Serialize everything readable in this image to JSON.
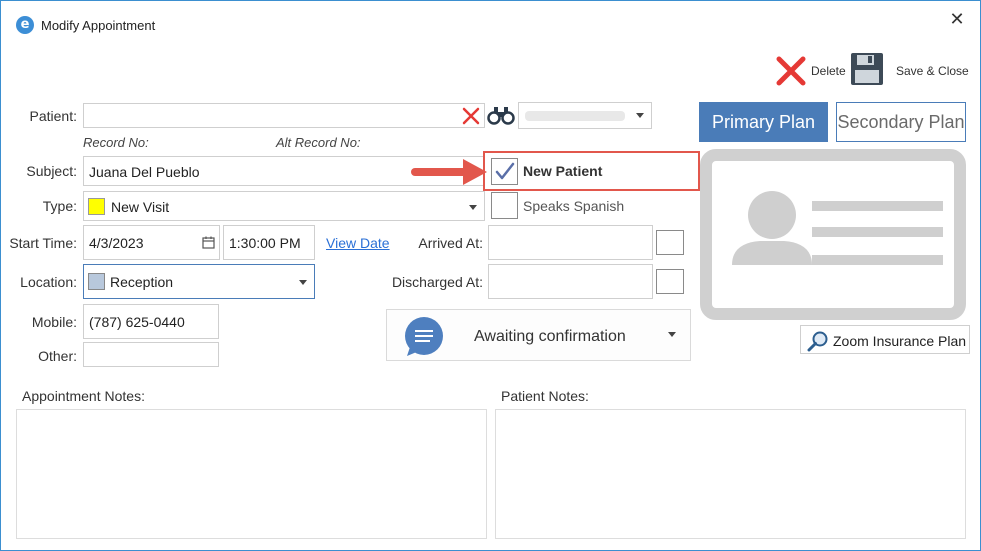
{
  "window": {
    "title": "Modify Appointment",
    "app_icon": "e"
  },
  "toolbar": {
    "delete_label": "Delete",
    "save_close_label": "Save & Close"
  },
  "patient": {
    "label": "Patient:",
    "value": "",
    "record_no_label": "Record No:",
    "alt_record_no_label": "Alt Record No:",
    "selector_value": ""
  },
  "subject": {
    "label": "Subject:",
    "value": "Juana Del Pueblo"
  },
  "type": {
    "label": "Type:",
    "value": "New Visit",
    "color": "#ffff00"
  },
  "start": {
    "label": "Start Time:",
    "date": "4/3/2023",
    "time": "1:30:00 PM",
    "view_date": "View Date"
  },
  "location": {
    "label": "Location:",
    "value": "Reception",
    "color": "#b8c8dc"
  },
  "mobile": {
    "label": "Mobile:",
    "value": "(787) 625-0440"
  },
  "other": {
    "label": "Other:",
    "value": ""
  },
  "checkboxes": {
    "new_patient": {
      "label": "New Patient",
      "checked": true
    },
    "speaks_spanish": {
      "label": "Speaks Spanish",
      "checked": false
    }
  },
  "arrived": {
    "label": "Arrived At:",
    "value": ""
  },
  "discharged": {
    "label": "Discharged At:",
    "value": ""
  },
  "status": {
    "value": "Awaiting confirmation"
  },
  "plans": {
    "primary": "Primary Plan",
    "secondary": "Secondary Plan",
    "zoom": "Zoom Insurance Plan"
  },
  "notes": {
    "appointment_label": "Appointment Notes:",
    "patient_label": "Patient Notes:"
  },
  "colors": {
    "accent": "#4a7cb8",
    "highlight": "#e2574c",
    "delete_red": "#e53935"
  }
}
